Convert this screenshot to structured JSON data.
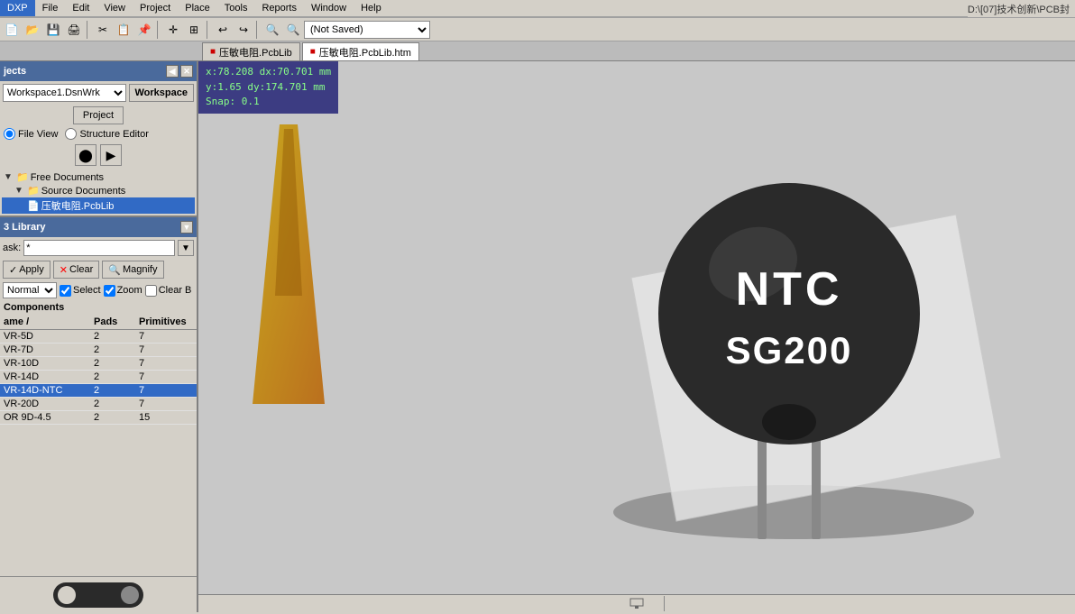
{
  "titlebar": {
    "right_text": "D:\\[07]技术创新\\PCB封"
  },
  "menubar": {
    "items": [
      "DXP",
      "File",
      "Edit",
      "View",
      "Project",
      "Place",
      "Tools",
      "Reports",
      "Window",
      "Help"
    ]
  },
  "toolbar": {
    "not_saved_label": "(Not Saved)"
  },
  "tabs": [
    {
      "label": "压敏电阻.PcbLib",
      "active": false
    },
    {
      "label": "压敏电阻.PcbLib.htm",
      "active": true
    }
  ],
  "projects_panel": {
    "title": "jects",
    "workspace_value": "Workspace1.DsnWrk",
    "workspace_btn": "Workspace",
    "project_btn": "Project",
    "file_view_label": "File View",
    "structure_editor_label": "Structure Editor"
  },
  "file_tree": {
    "free_documents": "Free Documents",
    "source_documents": "Source Documents",
    "file_item": "压敏电阻.PcbLib"
  },
  "library_panel": {
    "title": "3 Library",
    "mask_label": "ask:",
    "mask_value": "*",
    "apply_btn": "Apply",
    "clear_btn": "Clear",
    "magnify_btn": "Magnify",
    "filter_value": "Normal",
    "select_checkbox": "Select",
    "zoom_checkbox": "Zoom",
    "clear_b_checkbox": "Clear B",
    "components_label": "Components"
  },
  "components": {
    "col_name": "ame",
    "col_name_sort": "/",
    "col_pads": "Pads",
    "col_primitives": "Primitives",
    "rows": [
      {
        "name": "VR-5D",
        "pads": "2",
        "primitives": "7",
        "selected": false
      },
      {
        "name": "VR-7D",
        "pads": "2",
        "primitives": "7",
        "selected": false
      },
      {
        "name": "VR-10D",
        "pads": "2",
        "primitives": "7",
        "selected": false
      },
      {
        "name": "VR-14D",
        "pads": "2",
        "primitives": "7",
        "selected": false
      },
      {
        "name": "VR-14D-NTC",
        "pads": "2",
        "primitives": "7",
        "selected": true
      },
      {
        "name": "VR-20D",
        "pads": "2",
        "primitives": "7",
        "selected": false
      },
      {
        "name": "OR 9D-4.5",
        "pads": "2",
        "primitives": "15",
        "selected": false
      }
    ]
  },
  "info_overlay": {
    "line1": "x:78.208   dx:70.701 mm",
    "line2": "y:1.65   dy:174.701 mm",
    "line3": "Snap: 0.1"
  },
  "component_label_ntc": "NTC",
  "component_label_sg200": "SG200",
  "colors": {
    "selected_bg": "#316ac5",
    "panel_header": "#4a6a9c",
    "canvas_bg": "#c8c8c8"
  }
}
